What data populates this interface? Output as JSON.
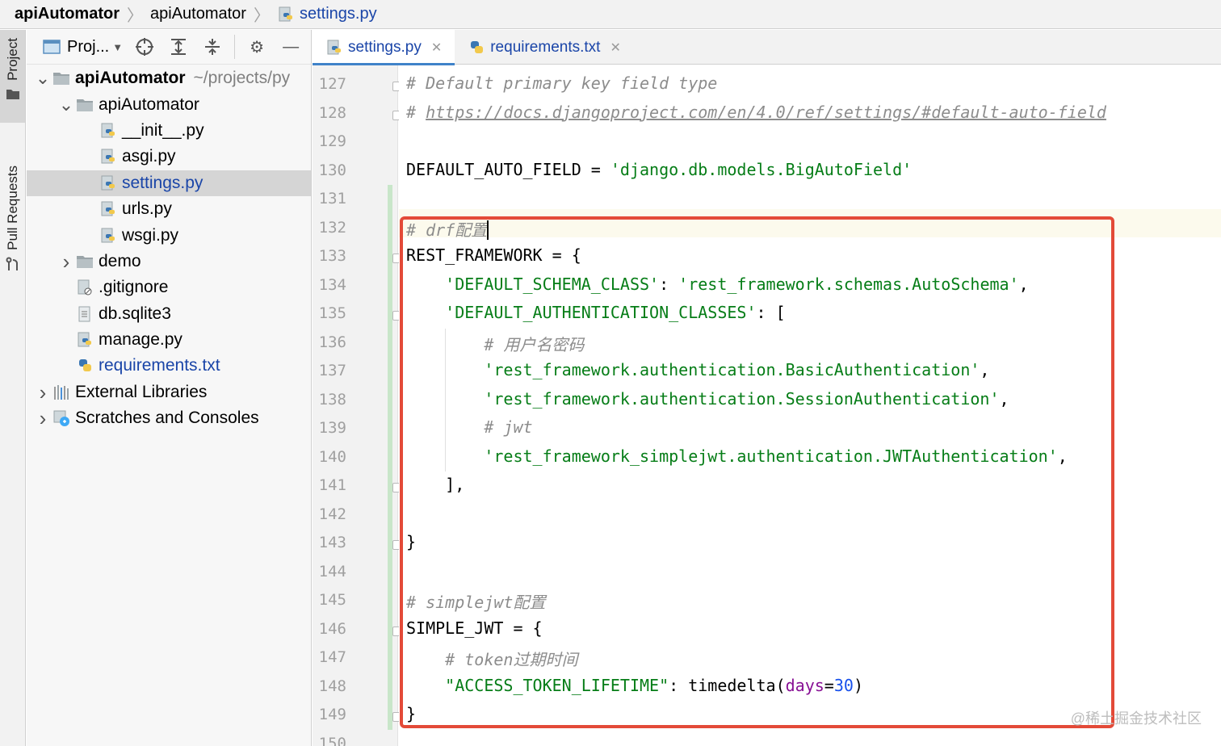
{
  "breadcrumb": [
    {
      "label": "apiAutomator",
      "bold": true
    },
    {
      "label": "apiAutomator"
    },
    {
      "label": "settings.py"
    }
  ],
  "stripe": {
    "project": "Project",
    "pull_requests": "Pull Requests"
  },
  "panel": {
    "title": "Proj..."
  },
  "tree": [
    {
      "label": "apiAutomator",
      "path": "~/projects/py",
      "bold": true,
      "depth": 0,
      "chev": "down",
      "icon": "folder-icon"
    },
    {
      "label": "apiAutomator",
      "depth": 1,
      "chev": "down",
      "icon": "folder-icon"
    },
    {
      "label": "__init__.py",
      "depth": 2,
      "icon": "python-file-icon"
    },
    {
      "label": "asgi.py",
      "depth": 2,
      "icon": "python-file-icon"
    },
    {
      "label": "settings.py",
      "depth": 2,
      "icon": "python-file-icon",
      "selected": true,
      "blue": true
    },
    {
      "label": "urls.py",
      "depth": 2,
      "icon": "python-file-icon"
    },
    {
      "label": "wsgi.py",
      "depth": 2,
      "icon": "python-file-icon"
    },
    {
      "label": "demo",
      "depth": 1,
      "chev": "right",
      "icon": "folder-icon"
    },
    {
      "label": ".gitignore",
      "depth": 1,
      "icon": "ignore-file-icon"
    },
    {
      "label": "db.sqlite3",
      "depth": 1,
      "icon": "text-file-icon"
    },
    {
      "label": "manage.py",
      "depth": 1,
      "icon": "python-file-icon"
    },
    {
      "label": "requirements.txt",
      "depth": 1,
      "icon": "requirements-file-icon",
      "blue": true
    },
    {
      "label": "External Libraries",
      "depth": 0,
      "chev": "right",
      "icon": "library-icon"
    },
    {
      "label": "Scratches and Consoles",
      "depth": 0,
      "chev": "right",
      "icon": "scratches-icon"
    }
  ],
  "tabs": [
    {
      "label": "settings.py",
      "active": true
    },
    {
      "label": "requirements.txt",
      "active": false
    }
  ],
  "editor": {
    "current_line": 132,
    "lines": [
      {
        "n": "127",
        "tokens": [
          {
            "t": "# Default primary key field type",
            "c": "comment"
          }
        ]
      },
      {
        "n": "128",
        "tokens": [
          {
            "t": "# ",
            "c": "comment"
          },
          {
            "t": "https://docs.djangoproject.com/en/4.0/ref/settings/#default-auto-field",
            "c": "url"
          }
        ]
      },
      {
        "n": "129",
        "tokens": []
      },
      {
        "n": "130",
        "tokens": [
          {
            "t": "DEFAULT_AUTO_FIELD = ",
            "c": "plain"
          },
          {
            "t": "'django.db.models.BigAutoField'",
            "c": "str"
          }
        ]
      },
      {
        "n": "131",
        "tokens": []
      },
      {
        "n": "132",
        "tokens": [
          {
            "t": "# drf配置",
            "c": "comment"
          }
        ],
        "caret": true
      },
      {
        "n": "133",
        "tokens": [
          {
            "t": "REST_FRAMEWORK = {",
            "c": "plain"
          }
        ]
      },
      {
        "n": "134",
        "tokens": [
          {
            "t": "    ",
            "c": "plain"
          },
          {
            "t": "'DEFAULT_SCHEMA_CLASS'",
            "c": "str"
          },
          {
            "t": ": ",
            "c": "plain"
          },
          {
            "t": "'rest_framework.schemas.AutoSchema'",
            "c": "str"
          },
          {
            "t": ",",
            "c": "plain"
          }
        ]
      },
      {
        "n": "135",
        "tokens": [
          {
            "t": "    ",
            "c": "plain"
          },
          {
            "t": "'DEFAULT_AUTHENTICATION_CLASSES'",
            "c": "str"
          },
          {
            "t": ": [",
            "c": "plain"
          }
        ]
      },
      {
        "n": "136",
        "tokens": [
          {
            "t": "        ",
            "c": "plain"
          },
          {
            "t": "# 用户名密码",
            "c": "comment"
          }
        ]
      },
      {
        "n": "137",
        "tokens": [
          {
            "t": "        ",
            "c": "plain"
          },
          {
            "t": "'rest_framework.authentication.BasicAuthentication'",
            "c": "str"
          },
          {
            "t": ",",
            "c": "plain"
          }
        ]
      },
      {
        "n": "138",
        "tokens": [
          {
            "t": "        ",
            "c": "plain"
          },
          {
            "t": "'rest_framework.authentication.SessionAuthentication'",
            "c": "str"
          },
          {
            "t": ",",
            "c": "plain"
          }
        ]
      },
      {
        "n": "139",
        "tokens": [
          {
            "t": "        ",
            "c": "plain"
          },
          {
            "t": "# jwt",
            "c": "comment"
          }
        ]
      },
      {
        "n": "140",
        "tokens": [
          {
            "t": "        ",
            "c": "plain"
          },
          {
            "t": "'rest_framework_simplejwt.authentication.JWTAuthentication'",
            "c": "str"
          },
          {
            "t": ",",
            "c": "plain"
          }
        ]
      },
      {
        "n": "141",
        "tokens": [
          {
            "t": "    ],",
            "c": "plain"
          }
        ]
      },
      {
        "n": "142",
        "tokens": []
      },
      {
        "n": "143",
        "tokens": [
          {
            "t": "}",
            "c": "plain"
          }
        ]
      },
      {
        "n": "144",
        "tokens": []
      },
      {
        "n": "145",
        "tokens": [
          {
            "t": "# simplejwt配置",
            "c": "comment"
          }
        ]
      },
      {
        "n": "146",
        "tokens": [
          {
            "t": "SIMPLE_JWT = {",
            "c": "plain"
          }
        ]
      },
      {
        "n": "147",
        "tokens": [
          {
            "t": "    ",
            "c": "plain"
          },
          {
            "t": "# token过期时间",
            "c": "comment"
          }
        ]
      },
      {
        "n": "148",
        "tokens": [
          {
            "t": "    ",
            "c": "plain"
          },
          {
            "t": "\"ACCESS_TOKEN_LIFETIME\"",
            "c": "str"
          },
          {
            "t": ": timedelta(",
            "c": "plain"
          },
          {
            "t": "days",
            "c": "kw"
          },
          {
            "t": "=",
            "c": "plain"
          },
          {
            "t": "30",
            "c": "num"
          },
          {
            "t": ")",
            "c": "plain"
          }
        ]
      },
      {
        "n": "149",
        "tokens": [
          {
            "t": "}",
            "c": "plain"
          }
        ]
      },
      {
        "n": "150",
        "tokens": []
      }
    ]
  },
  "watermark": "@稀土掘金技术社区",
  "colors": {
    "highlight_box": "#e34a38",
    "string": "#067d17",
    "comment": "#8c8c8c",
    "keyword_arg": "#871094",
    "number": "#1750eb",
    "link": "#1a45a8"
  }
}
